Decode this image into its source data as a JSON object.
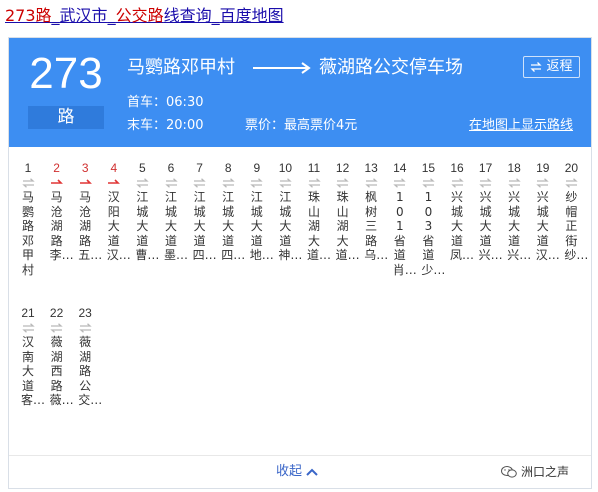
{
  "title": {
    "route": "273路",
    "sep1": "_",
    "city": "武汉市",
    "sep2": "_",
    "category": "公交路",
    "line_word": "线查询",
    "sep3": "_",
    "site": "百度地图"
  },
  "header": {
    "route_number": "273",
    "route_unit": "路",
    "from_stop": "马鹦路邓甲村",
    "to_stop": "薇湖路公交停车场",
    "return_label": "返程",
    "first_bus_label": "首车：",
    "first_bus_time": "06:30",
    "last_bus_label": "末车：",
    "last_bus_time": "20:00",
    "fare_label": "票价：",
    "fare_value": "最高票价4元",
    "map_link": "在地图上显示路线"
  },
  "colors": {
    "header_bg": "#3d8ef2",
    "active_arrow": "#e03535",
    "inactive_arrow": "#b9b9b9",
    "link_blue": "#3a66c8"
  },
  "stops": [
    {
      "index": "1",
      "name": "马鹦路邓甲村",
      "active": false
    },
    {
      "index": "2",
      "name": "马沧湖路李…",
      "active": true
    },
    {
      "index": "3",
      "name": "马沧湖路五…",
      "active": true
    },
    {
      "index": "4",
      "name": "汉阳大道汉…",
      "active": true
    },
    {
      "index": "5",
      "name": "江城大道曹…",
      "active": false
    },
    {
      "index": "6",
      "name": "江城大道墨…",
      "active": false
    },
    {
      "index": "7",
      "name": "江城大道四…",
      "active": false
    },
    {
      "index": "8",
      "name": "江城大道四…",
      "active": false
    },
    {
      "index": "9",
      "name": "江城大道地…",
      "active": false
    },
    {
      "index": "10",
      "name": "江城大道神…",
      "active": false
    },
    {
      "index": "11",
      "name": "珠山湖大道…",
      "active": false
    },
    {
      "index": "12",
      "name": "珠山湖大道…",
      "active": false
    },
    {
      "index": "13",
      "name": "枫树三路乌…",
      "active": false
    },
    {
      "index": "14",
      "name": "101省道肖…",
      "active": false
    },
    {
      "index": "15",
      "name": "103省道少…",
      "active": false
    },
    {
      "index": "16",
      "name": "兴城大道凤…",
      "active": false
    },
    {
      "index": "17",
      "name": "兴城大道兴…",
      "active": false
    },
    {
      "index": "18",
      "name": "兴城大道兴…",
      "active": false
    },
    {
      "index": "19",
      "name": "兴城大道汉…",
      "active": false
    },
    {
      "index": "20",
      "name": "纱帽正街纱…",
      "active": false
    },
    {
      "index": "21",
      "name": "汉南大道客…",
      "active": false
    },
    {
      "index": "22",
      "name": "薇湖西路薇…",
      "active": false
    },
    {
      "index": "23",
      "name": "薇湖路公交…",
      "active": false
    }
  ],
  "footer": {
    "collapse_label": "收起",
    "watermark": "洲口之声"
  }
}
